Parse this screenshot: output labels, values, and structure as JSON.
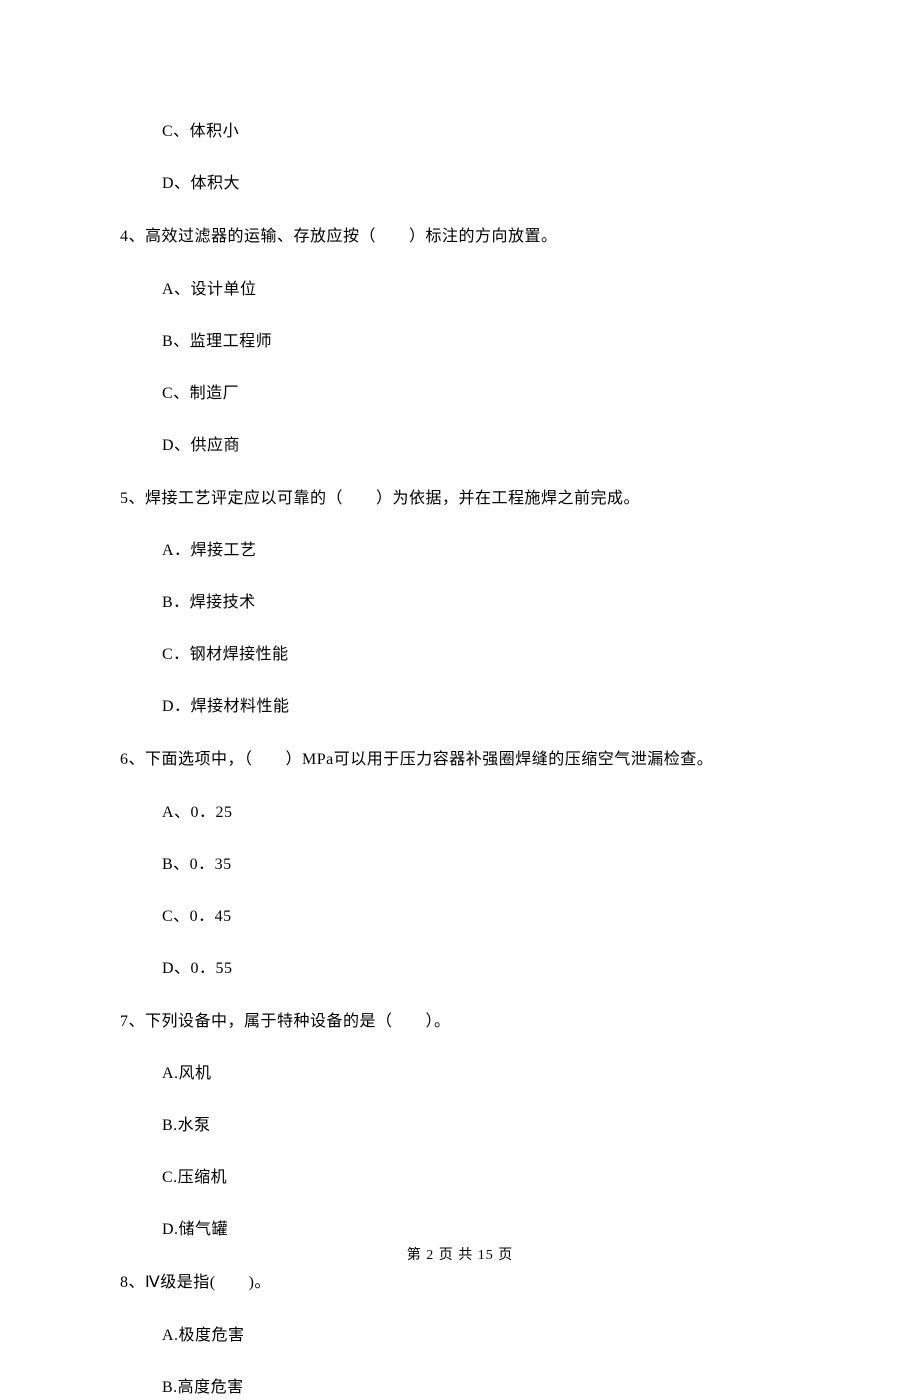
{
  "questions": [
    {
      "options_prev": [
        "C、体积小",
        "D、体积大"
      ]
    },
    {
      "stem": "4、高效过滤器的运输、存放应按（　　）标注的方向放置。",
      "options": [
        "A、设计单位",
        "B、监理工程师",
        "C、制造厂",
        "D、供应商"
      ]
    },
    {
      "stem": "5、焊接工艺评定应以可靠的（　　）为依据，并在工程施焊之前完成。",
      "options": [
        "A．焊接工艺",
        "B．焊接技术",
        "C．钢材焊接性能",
        "D．焊接材料性能"
      ]
    },
    {
      "stem": "6、下面选项中，（　　）MPa可以用于压力容器补强圈焊缝的压缩空气泄漏检查。",
      "options": [
        "A、0．25",
        "B、0．35",
        "C、0．45",
        "D、0．55"
      ]
    },
    {
      "stem": "7、下列设备中，属于特种设备的是（　　）。",
      "options": [
        "A.风机",
        "B.水泵",
        "C.压缩机",
        "D.储气罐"
      ]
    },
    {
      "stem": "8、Ⅳ级是指(　　)。",
      "options": [
        "A.极度危害",
        "B.高度危害"
      ]
    }
  ],
  "footer": "第 2 页 共 15 页"
}
